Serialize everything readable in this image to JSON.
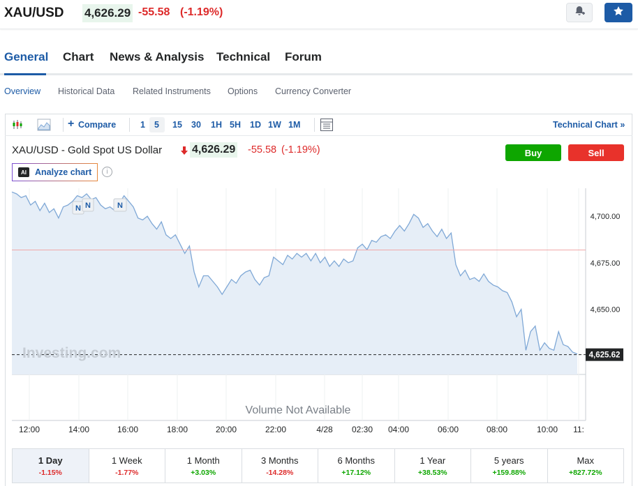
{
  "header": {
    "symbol": "XAU/USD",
    "price": "4,626.29",
    "change": "-55.58",
    "change_pct": "(-1.19%)"
  },
  "tabs": [
    {
      "label": "General",
      "active": true
    },
    {
      "label": "Chart"
    },
    {
      "label": "News & Analysis"
    },
    {
      "label": "Technical"
    },
    {
      "label": "Forum"
    }
  ],
  "subnav": [
    {
      "label": "Overview",
      "active": true
    },
    {
      "label": "Historical Data"
    },
    {
      "label": "Related Instruments"
    },
    {
      "label": "Options"
    },
    {
      "label": "Currency Converter"
    }
  ],
  "toolbar": {
    "compare_label": "Compare",
    "intervals": [
      "1",
      "5",
      "15",
      "30",
      "1H",
      "5H",
      "1D",
      "1W",
      "1M"
    ],
    "selected_interval": "5",
    "technical_chart_label": "Technical Chart »"
  },
  "chart_header": {
    "title": "XAU/USD - Gold Spot US Dollar",
    "price": "4,626.29",
    "change": "-55.58",
    "change_pct": "(-1.19%)",
    "buy_label": "Buy",
    "sell_label": "Sell",
    "analyze_label": "Analyze chart",
    "ai_badge": "AI"
  },
  "chart_data": {
    "type": "area",
    "x_ticks": [
      "12:00",
      "14:00",
      "16:00",
      "18:00",
      "20:00",
      "22:00",
      "4/28",
      "02:30",
      "04:00",
      "06:00",
      "08:00",
      "10:00",
      "11:"
    ],
    "y_ticks": [
      "4,700.00",
      "4,675.00",
      "4,650.00"
    ],
    "y_tick_values": [
      4700,
      4675,
      4650
    ],
    "ylim": [
      4615,
      4715
    ],
    "reference_line": 4681.87,
    "last_price_label": "4,625.62",
    "last_price": 4625.62,
    "news_markers": [
      "N",
      "N",
      "N"
    ],
    "watermark": "Investing.com",
    "volume_note": "Volume Not Available",
    "series": [
      {
        "values": [
          4713,
          4712,
          4710,
          4711,
          4706,
          4708,
          4703,
          4707,
          4702,
          4704,
          4699,
          4705,
          4706,
          4708,
          4711,
          4710,
          4712,
          4709,
          4710,
          4706,
          4704,
          4705,
          4703,
          4707,
          4711,
          4708,
          4705,
          4699,
          4698,
          4700,
          4696,
          4693,
          4697,
          4690,
          4688,
          4690,
          4685,
          4680,
          4684,
          4670,
          4662,
          4668,
          4668,
          4665,
          4662,
          4658,
          4662,
          4666,
          4664,
          4668,
          4670,
          4671,
          4666,
          4663,
          4667,
          4668,
          4678,
          4676,
          4674,
          4679,
          4677,
          4680,
          4678,
          4680,
          4676,
          4680,
          4675,
          4678,
          4673,
          4676,
          4673,
          4677,
          4675,
          4676,
          4683,
          4685,
          4682,
          4687,
          4686,
          4689,
          4690,
          4688,
          4692,
          4695,
          4692,
          4696,
          4701,
          4699,
          4694,
          4696,
          4692,
          4689,
          4693,
          4688,
          4691,
          4674,
          4668,
          4671,
          4666,
          4667,
          4665,
          4669,
          4665,
          4663,
          4662,
          4660,
          4659,
          4654,
          4646,
          4650,
          4628,
          4638,
          4641,
          4628,
          4632,
          4629,
          4628,
          4638,
          4631,
          4630,
          4627,
          4626
        ]
      }
    ]
  },
  "periods": [
    {
      "label": "1 Day",
      "value": "-1.15%",
      "dir": "neg",
      "active": true
    },
    {
      "label": "1 Week",
      "value": "-1.77%",
      "dir": "neg"
    },
    {
      "label": "1 Month",
      "value": "+3.03%",
      "dir": "pos"
    },
    {
      "label": "3 Months",
      "value": "-14.28%",
      "dir": "neg"
    },
    {
      "label": "6 Months",
      "value": "+17.12%",
      "dir": "pos"
    },
    {
      "label": "1 Year",
      "value": "+38.53%",
      "dir": "pos"
    },
    {
      "label": "5 years",
      "value": "+159.88%",
      "dir": "pos"
    },
    {
      "label": "Max",
      "value": "+827.72%",
      "dir": "pos"
    }
  ],
  "colors": {
    "accent": "#1d5ba6",
    "negative": "#dd2a2a",
    "positive": "#0ea600",
    "line": "#7fa8d6",
    "area": "#e6eef7"
  },
  "icons": [
    "bell-plus-icon",
    "star-icon",
    "candlestick-icon",
    "area-chart-icon",
    "plus-icon",
    "table-icon",
    "arrow-down-icon",
    "info-icon"
  ]
}
